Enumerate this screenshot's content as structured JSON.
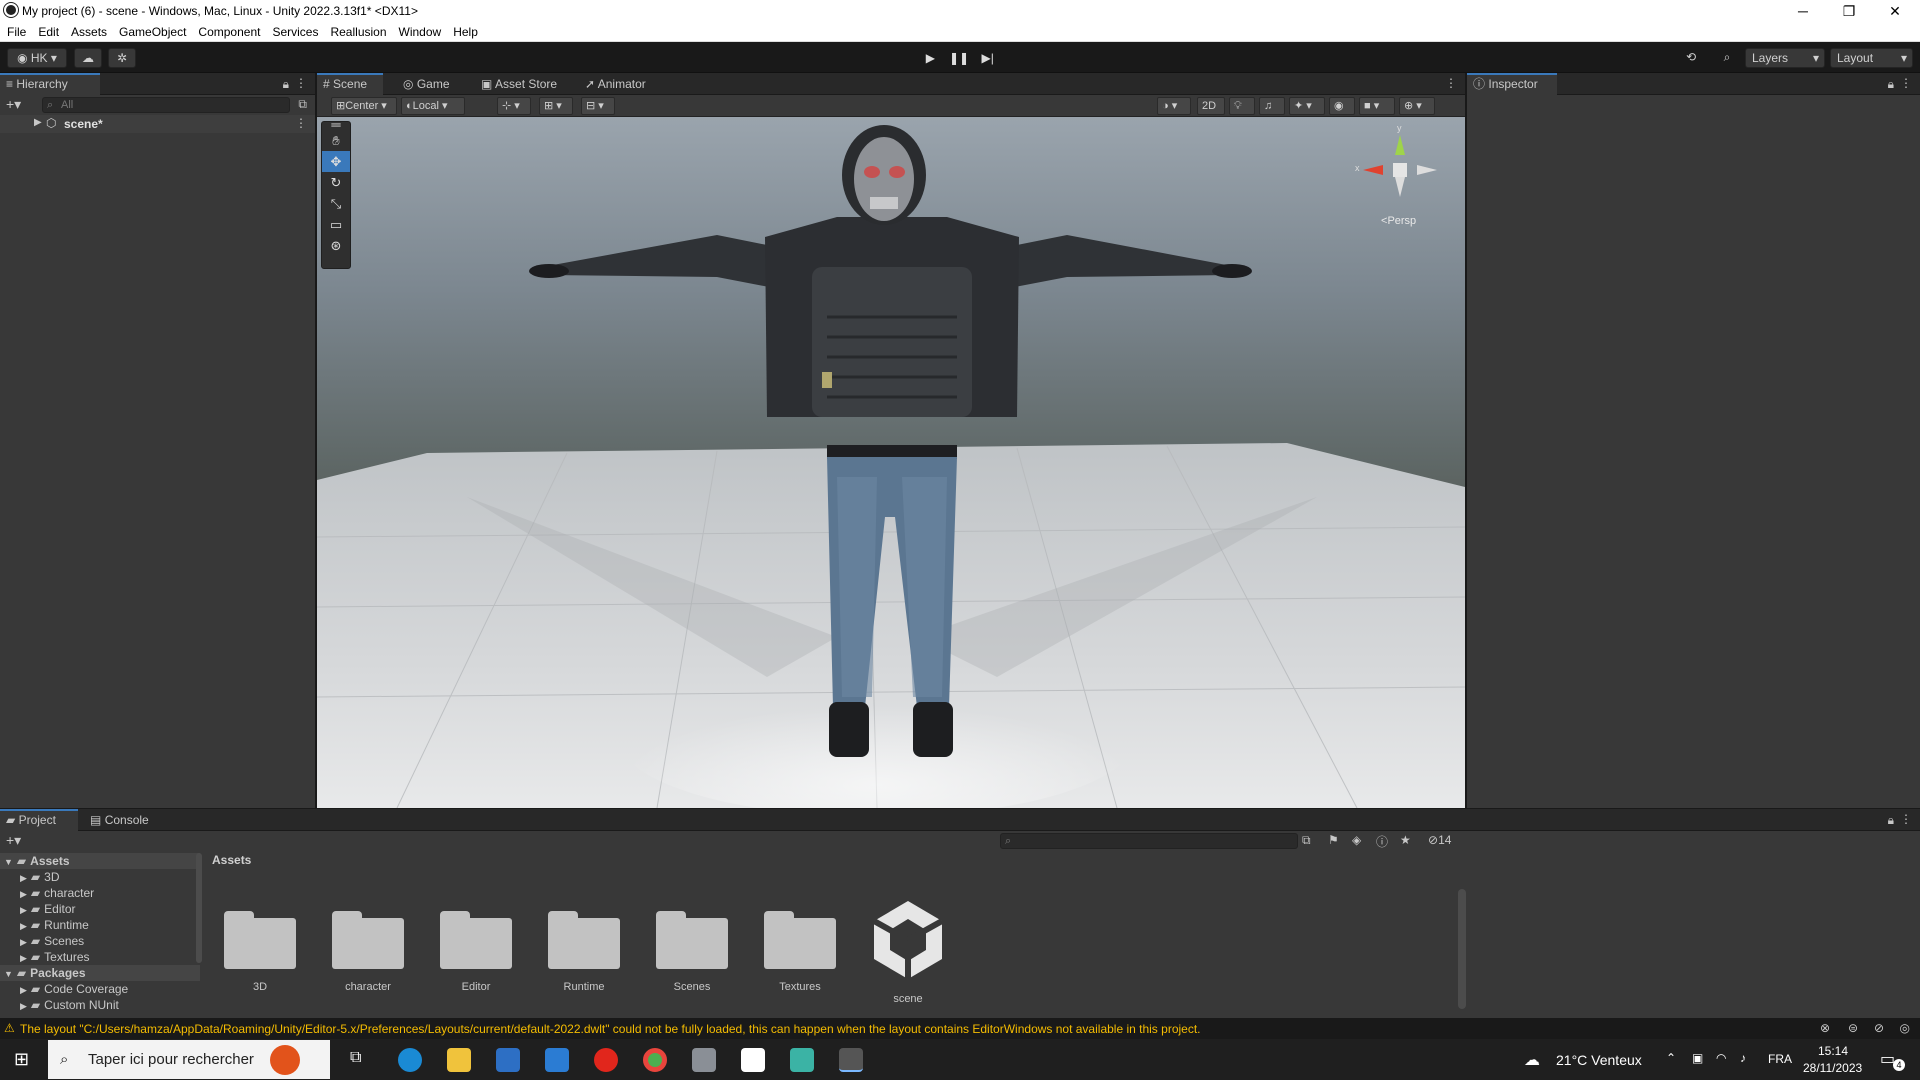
{
  "window": {
    "title": "My project (6) - scene - Windows, Mac, Linux - Unity 2022.3.13f1* <DX11>",
    "controls": [
      "─",
      "❐",
      "✕"
    ]
  },
  "menu": [
    "File",
    "Edit",
    "Assets",
    "GameObject",
    "Component",
    "Services",
    "Reallusion",
    "Window",
    "Help"
  ],
  "toolbar": {
    "account": "HK",
    "layers": "Layers",
    "layout": "Layout"
  },
  "hierarchy": {
    "tab": "Hierarchy",
    "search_placeholder": "All",
    "scene_item": "scene*"
  },
  "scene_tabs": [
    "Scene",
    "Game",
    "Asset Store",
    "Animator"
  ],
  "scene_toolbar": {
    "pivot": "Center",
    "space": "Local",
    "mode_2d": "2D"
  },
  "gizmo": {
    "projection": "Persp",
    "axis_x": "x",
    "axis_y": "y"
  },
  "inspector": {
    "tab": "Inspector"
  },
  "project": {
    "tabs": [
      "Project",
      "Console"
    ],
    "breadcrumb": "Assets",
    "hidden_count": "14",
    "tree": [
      {
        "label": "Assets",
        "level": 0,
        "bold": true
      },
      {
        "label": "3D",
        "level": 1
      },
      {
        "label": "character",
        "level": 1
      },
      {
        "label": "Editor",
        "level": 1
      },
      {
        "label": "Runtime",
        "level": 1
      },
      {
        "label": "Scenes",
        "level": 1
      },
      {
        "label": "Textures",
        "level": 1
      },
      {
        "label": "Packages",
        "level": 0,
        "bold": true
      },
      {
        "label": "Code Coverage",
        "level": 1
      },
      {
        "label": "Custom NUnit",
        "level": 1
      }
    ],
    "assets": [
      {
        "label": "3D",
        "type": "folder"
      },
      {
        "label": "character",
        "type": "folder"
      },
      {
        "label": "Editor",
        "type": "folder"
      },
      {
        "label": "Runtime",
        "type": "folder"
      },
      {
        "label": "Scenes",
        "type": "folder"
      },
      {
        "label": "Textures",
        "type": "folder"
      },
      {
        "label": "scene",
        "type": "unity-scene"
      }
    ]
  },
  "status": {
    "message": "The layout \"C:/Users/hamza/AppData/Roaming/Unity/Editor-5.x/Preferences/Layouts/current/default-2022.dwlt\" could not be fully loaded, this can happen when the layout contains EditorWindows not available in this project."
  },
  "taskbar": {
    "search_placeholder": "Taper ici pour rechercher",
    "weather": "21°C  Venteux",
    "language": "FRA",
    "time": "15:14",
    "date": "28/11/2023",
    "notifications": "4"
  },
  "colors": {
    "accent": "#3a79bb",
    "warning": "#f4bc02",
    "panel": "#383838",
    "dark": "#191919"
  }
}
